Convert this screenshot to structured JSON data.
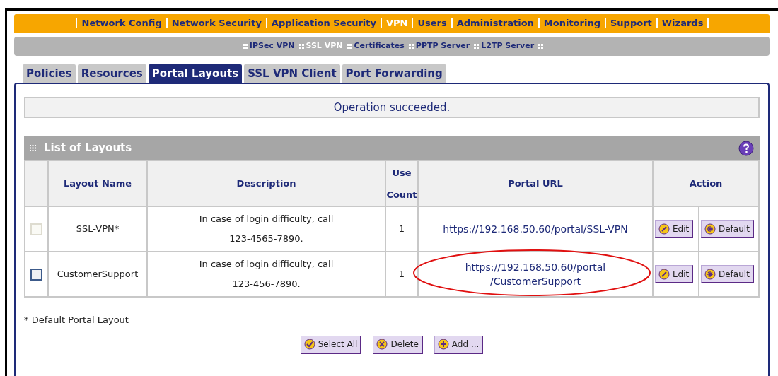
{
  "main_menu": [
    {
      "label": "Network Config",
      "selected": false
    },
    {
      "label": "Network Security",
      "selected": false
    },
    {
      "label": "Application Security",
      "selected": false
    },
    {
      "label": "VPN",
      "selected": true
    },
    {
      "label": "Users",
      "selected": false
    },
    {
      "label": "Administration",
      "selected": false
    },
    {
      "label": "Monitoring",
      "selected": false
    },
    {
      "label": "Support",
      "selected": false
    },
    {
      "label": "Wizards",
      "selected": false
    }
  ],
  "sub_menu": [
    {
      "label": "IPSec VPN",
      "selected": false
    },
    {
      "label": "SSL VPN",
      "selected": true
    },
    {
      "label": "Certificates",
      "selected": false
    },
    {
      "label": "PPTP Server",
      "selected": false
    },
    {
      "label": "L2TP Server",
      "selected": false
    }
  ],
  "tabs": [
    {
      "label": "Policies",
      "selected": false
    },
    {
      "label": "Resources",
      "selected": false
    },
    {
      "label": "Portal Layouts",
      "selected": true
    },
    {
      "label": "SSL VPN Client",
      "selected": false
    },
    {
      "label": "Port Forwarding",
      "selected": false
    }
  ],
  "message": "Operation succeeded.",
  "section_title": "List of Layouts",
  "table": {
    "columns": [
      "Layout Name",
      "Description",
      "Use Count",
      "Portal URL",
      "Action"
    ],
    "rows": [
      {
        "disabled": true,
        "highlighted": false,
        "name": "SSL-VPN*",
        "description": [
          "In case of login difficulty, call",
          "123-4565-7890."
        ],
        "use_count": "1",
        "portal_url": [
          "https://192.168.50.60/portal/SSL-VPN"
        ],
        "actions": [
          "Edit",
          "Default"
        ]
      },
      {
        "disabled": false,
        "highlighted": true,
        "name": "CustomerSupport",
        "description": [
          "In case of login difficulty, call",
          "123-456-7890."
        ],
        "use_count": "1",
        "portal_url": [
          "https://192.168.50.60/portal",
          "/CustomerSupport"
        ],
        "actions": [
          "Edit",
          "Default"
        ]
      }
    ]
  },
  "footnote": "* Default Portal Layout",
  "buttons": [
    {
      "kind": "check",
      "label": "Select All"
    },
    {
      "kind": "cross",
      "label": "Delete"
    },
    {
      "kind": "plus",
      "label": "Add ..."
    }
  ]
}
